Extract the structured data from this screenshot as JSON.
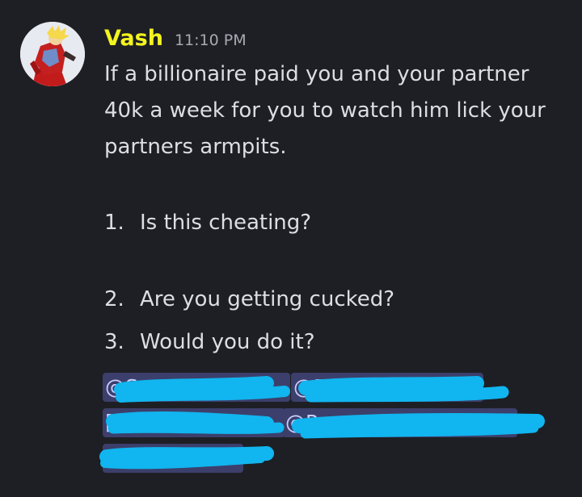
{
  "message": {
    "username": "Vash",
    "timestamp": "11:10 PM",
    "avatar_icon": "vash-avatar-icon",
    "lines": [
      "If a billionaire paid you and your partner",
      "40k a week for you to watch him lick your",
      "partners armpits."
    ],
    "list": [
      {
        "num": "1.",
        "text": "Is this cheating?"
      },
      {
        "num": "2.",
        "text": "Are you getting cucked?"
      },
      {
        "num": "3.",
        "text": "Would you do it?"
      }
    ],
    "mentions": [
      "@S",
      "@B",
      "[M",
      "@P",
      "@M"
    ]
  },
  "colors": {
    "background": "#1e1f24",
    "username": "#f4f41f",
    "text": "#dcdee3",
    "mention_bg": "#3c3f6b",
    "redaction": "#11b5ef"
  }
}
